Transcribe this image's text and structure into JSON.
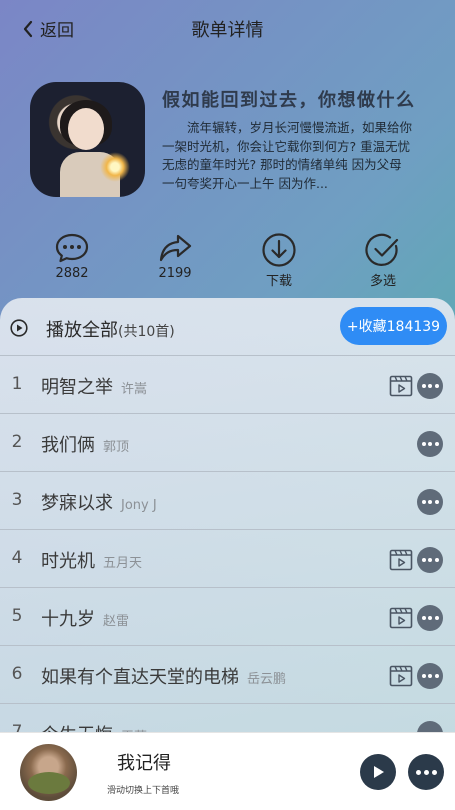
{
  "header": {
    "back_label": "返回",
    "title": "歌单详情"
  },
  "playlist": {
    "title": "假如能回到过去，你想做什么",
    "description": "流年辗转，岁月长河慢慢流逝，如果给你一架时光机，你会让它载你到何方? 重温无忧无虑的童年时光? 那时的情绪单纯 因为父母一句夸奖开心一上午 因为作..."
  },
  "actions": [
    {
      "icon": "comment-icon",
      "label": "2882"
    },
    {
      "icon": "share-icon",
      "label": "2199"
    },
    {
      "icon": "download-icon",
      "label": "下载"
    },
    {
      "icon": "multi-select-icon",
      "label": "多选"
    }
  ],
  "list_header": {
    "play_all_label": "播放全部",
    "count_label": "(共10首)",
    "collect_label": "+收藏184139"
  },
  "songs": [
    {
      "index": "1",
      "name": "明智之举",
      "artist": "许嵩",
      "has_mv": true
    },
    {
      "index": "2",
      "name": "我们俩",
      "artist": "郭顶",
      "has_mv": false
    },
    {
      "index": "3",
      "name": "梦寐以求",
      "artist": "Jony J",
      "has_mv": false
    },
    {
      "index": "4",
      "name": "时光机",
      "artist": "五月天",
      "has_mv": true
    },
    {
      "index": "5",
      "name": "十九岁",
      "artist": "赵雷",
      "has_mv": true
    },
    {
      "index": "6",
      "name": "如果有个直达天堂的电梯",
      "artist": "岳云鹏",
      "has_mv": true
    },
    {
      "index": "7",
      "name": "今生无悔",
      "artist": "王菲",
      "has_mv": false
    }
  ],
  "player": {
    "title": "我记得",
    "hint": "滑动切换上下首哦"
  },
  "colors": {
    "accent": "#2f8cf5",
    "gradient_start": "#7b86c6",
    "gradient_end": "#3fbc9a",
    "dark_button": "#2b3a4a"
  }
}
